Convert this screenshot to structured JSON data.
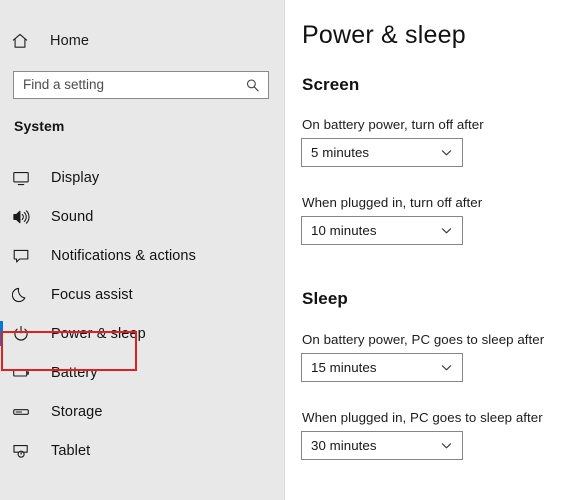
{
  "sidebar": {
    "home": {
      "label": "Home",
      "icon": "home-icon"
    },
    "search": {
      "placeholder": "Find a setting",
      "value": "",
      "icon": "search-icon"
    },
    "group_title": "System",
    "items": [
      {
        "label": "Display",
        "icon": "monitor-icon",
        "selected": false
      },
      {
        "label": "Sound",
        "icon": "speaker-icon",
        "selected": false
      },
      {
        "label": "Notifications & actions",
        "icon": "notification-icon",
        "selected": false
      },
      {
        "label": "Focus assist",
        "icon": "moon-icon",
        "selected": false
      },
      {
        "label": "Power & sleep",
        "icon": "power-icon",
        "selected": true
      },
      {
        "label": "Battery",
        "icon": "battery-icon",
        "selected": false
      },
      {
        "label": "Storage",
        "icon": "storage-icon",
        "selected": false
      },
      {
        "label": "Tablet",
        "icon": "tablet-icon",
        "selected": false
      }
    ]
  },
  "main": {
    "page_title": "Power & sleep",
    "sections": [
      {
        "heading": "Screen",
        "fields": [
          {
            "label": "On battery power, turn off after",
            "value": "5 minutes"
          },
          {
            "label": "When plugged in, turn off after",
            "value": "10 minutes"
          }
        ]
      },
      {
        "heading": "Sleep",
        "fields": [
          {
            "label": "On battery power, PC goes to sleep after",
            "value": "15 minutes"
          },
          {
            "label": "When plugged in, PC goes to sleep after",
            "value": "30 minutes"
          }
        ]
      }
    ]
  },
  "annotation": {
    "target": "Power & sleep",
    "color": "#e02020"
  },
  "colors": {
    "sidebar_bg": "#e8e8e8",
    "content_bg": "#ffffff",
    "accent": "#0078d7",
    "annotation": "#e02020",
    "text": "#121212"
  }
}
